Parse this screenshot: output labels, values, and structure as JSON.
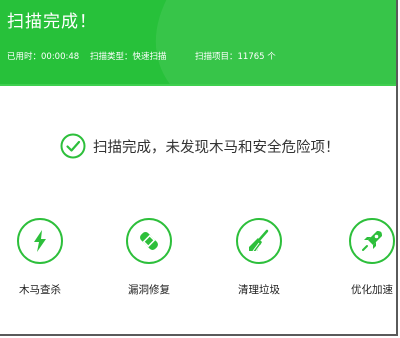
{
  "header": {
    "title": "扫描完成！",
    "elapsed": "已用时：00:00:48",
    "scan_type": "扫描类型：快速扫描",
    "scan_items": "扫描项目：11765 个"
  },
  "result": {
    "message": "扫描完成，未发现木马和安全危险项！"
  },
  "tools": [
    {
      "label": "木马查杀",
      "icon": "lightning-icon"
    },
    {
      "label": "漏洞修复",
      "icon": "patch-icon"
    },
    {
      "label": "清理垃圾",
      "icon": "broom-icon"
    },
    {
      "label": "优化加速",
      "icon": "rocket-icon"
    }
  ],
  "colors": {
    "accent": "#27c13a",
    "text": "#333333"
  }
}
